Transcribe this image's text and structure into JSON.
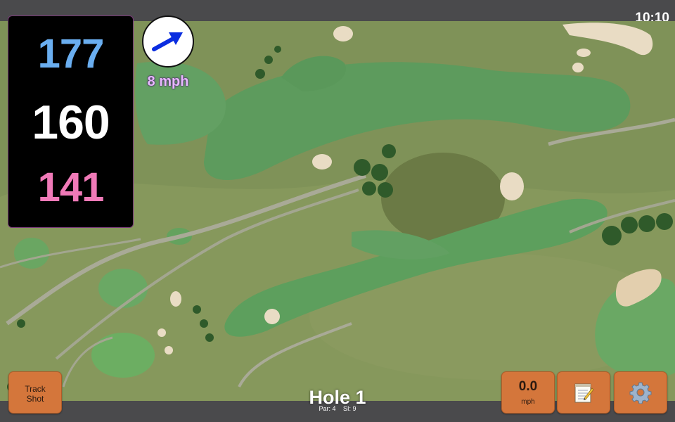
{
  "status_bar": {
    "time": "10:10"
  },
  "distances": {
    "back": "177",
    "middle": "160",
    "front": "141"
  },
  "wind": {
    "speed_label": "8 mph",
    "direction_icon": "arrow-icon"
  },
  "hole": {
    "title": "Hole 1",
    "par": "Par: 4",
    "si": "SI: 9"
  },
  "buttons": {
    "track_shot": {
      "line1": "Track",
      "line2": "Shot"
    },
    "wind_speed": {
      "value": "0.0",
      "unit": "mph"
    },
    "notes_icon": "notepad-icon",
    "settings_icon": "gear-icon"
  },
  "colors": {
    "back_distance": "#6aaef0",
    "middle_distance": "#ffffff",
    "front_distance": "#f07ab8",
    "button": "#d4763b",
    "wind_label": "#e8b9ff"
  }
}
